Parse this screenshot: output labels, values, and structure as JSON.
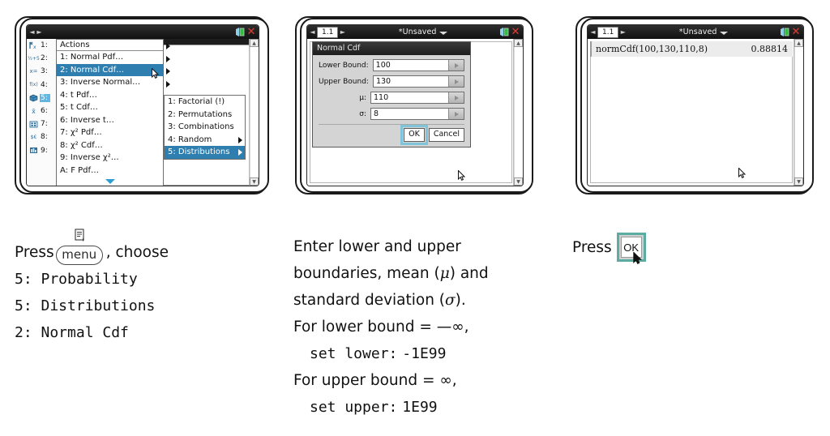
{
  "screens": [
    {
      "name": "menu-screen",
      "titlebar": {
        "tab": "",
        "title": "",
        "battery_icon": "battery-icon",
        "close_icon": "close-icon"
      },
      "icon_column": [
        {
          "glyph": "Yₓ",
          "num": "1:"
        },
        {
          "glyph": "½+5",
          "num": "2:"
        },
        {
          "glyph": "x=",
          "num": "3:"
        },
        {
          "glyph": "f(x)",
          "num": "4:"
        },
        {
          "glyph": "⚂",
          "num": "5:",
          "selected": true
        },
        {
          "glyph": "x̄",
          "num": "6:"
        },
        {
          "glyph": "░",
          "num": "7:"
        },
        {
          "glyph": "$€",
          "num": "8:"
        },
        {
          "glyph": "▓",
          "num": "9:"
        }
      ],
      "menu_header": "Actions",
      "menu_items": [
        {
          "label": "1: Normal Pdf…",
          "submenu": true,
          "selected": false
        },
        {
          "label": "2: Normal Cdf…",
          "submenu": true,
          "selected": true
        },
        {
          "label": "3: Inverse Normal…",
          "submenu": true,
          "selected": false
        },
        {
          "label": "4: t Pdf…",
          "submenu": false,
          "selected": false
        },
        {
          "label": "5: t Cdf…",
          "submenu": false,
          "selected": false
        },
        {
          "label": "6: Inverse t…",
          "submenu": false,
          "selected": false
        },
        {
          "label": "7: χ² Pdf…",
          "submenu": false,
          "selected": false
        },
        {
          "label": "8: χ² Cdf…",
          "submenu": false,
          "selected": false
        },
        {
          "label": "9: Inverse χ²…",
          "submenu": false,
          "selected": false
        },
        {
          "label": "A: F Pdf…",
          "submenu": false,
          "selected": false
        }
      ],
      "submenu_items": [
        {
          "label": "1: Factorial (!)",
          "submenu": false,
          "selected": false
        },
        {
          "label": "2: Permutations",
          "submenu": false,
          "selected": false
        },
        {
          "label": "3: Combinations",
          "submenu": false,
          "selected": false
        },
        {
          "label": "4: Random",
          "submenu": true,
          "selected": false
        },
        {
          "label": "5: Distributions",
          "submenu": true,
          "selected": true
        }
      ]
    },
    {
      "name": "dialog-screen",
      "titlebar": {
        "tab": "1.1",
        "title": "*Unsaved",
        "battery_icon": "battery-icon",
        "close_icon": "close-icon"
      },
      "dialog": {
        "title": "Normal Cdf",
        "fields": [
          {
            "label": "Lower Bound:",
            "value": "100"
          },
          {
            "label": "Upper Bound:",
            "value": "130"
          },
          {
            "label": "μ:",
            "value": "110"
          },
          {
            "label": "σ:",
            "value": "8"
          }
        ],
        "ok_label": "OK",
        "cancel_label": "Cancel"
      }
    },
    {
      "name": "result-screen",
      "titlebar": {
        "tab": "1.1",
        "title": "*Unsaved",
        "battery_icon": "battery-icon",
        "close_icon": "close-icon"
      },
      "result": {
        "expression": "normCdf(100,130,110,8)",
        "value": "0.88814"
      }
    }
  ],
  "captions": {
    "step1": {
      "press_word": "Press",
      "key_label": "menu",
      "after_key": ", choose",
      "lines": [
        "5: Probability",
        "5: Distributions",
        "2: Normal Cdf"
      ]
    },
    "step2": {
      "lines": [
        "Enter lower and upper",
        "boundaries, mean (μ) and",
        "standard deviation (σ).",
        "For lower bound = —∞,",
        "set lower: -1E99",
        "For upper bound = ∞,",
        "set upper: 1E99"
      ],
      "l1": "Enter lower and upper",
      "l2a": "boundaries, mean (",
      "l2mu": "μ",
      "l2b": ") and",
      "l3a": "standard deviation (",
      "l3sig": "σ",
      "l3b": ").",
      "l4": "For lower bound = —∞,",
      "l5a": "set lower:",
      "l5b": "-1E99",
      "l6": "For upper bound = ∞,",
      "l7a": "set upper:",
      "l7b": "1E99"
    },
    "step3": {
      "press_word": "Press",
      "key_label": "OK"
    }
  },
  "colors": {
    "menu_highlight": "#2e7fb0",
    "submenu_highlight": "#63b6e0",
    "focus_ring": "#7fc4d8",
    "close_red": "#e33b32",
    "battery_green": "#2fbf3f"
  }
}
